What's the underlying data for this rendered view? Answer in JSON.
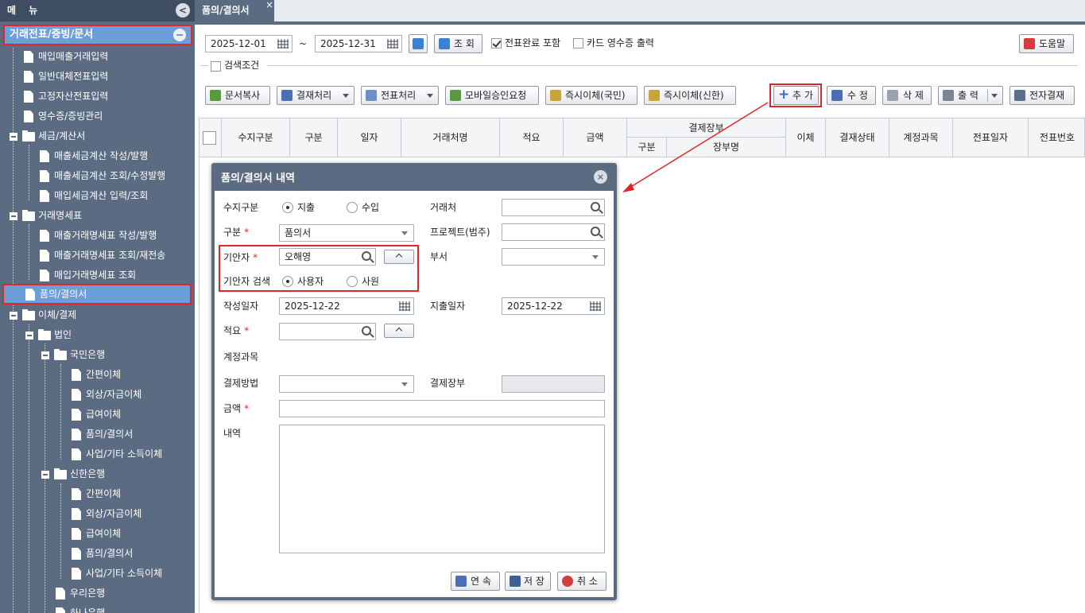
{
  "sidebar": {
    "title": "메 뉴",
    "collapse_icon": "<",
    "group": "거래전표/증빙/문서",
    "items": [
      "매입매출거래입력",
      "일반대체전표입력",
      "고정자산전표입력",
      "영수증/증빙관리",
      "세금/계산서",
      "매출세금계산 작성/발행",
      "매출세금계산 조회/수정발행",
      "매입세금계산 입력/조회",
      "거래명세표",
      "매출거래명세표 작성/발행",
      "매출거래명세표 조회/재전송",
      "매입거래명세표 조회",
      "품의/결의서",
      "이체/결제",
      "법인",
      "국민은행",
      "간편이체",
      "외상/자금이체",
      "급여이체",
      "품의/결의서",
      "사업/기타 소득이체",
      "신한은행",
      "간편이체",
      "외상/자금이체",
      "급여이체",
      "품의/결의서",
      "사업/기타 소득이체",
      "우리은행",
      "하나은행"
    ]
  },
  "tabs": {
    "active": "품의/결의서",
    "close": "×"
  },
  "toolbar": {
    "date_from": "2025-12-01",
    "tilde": "~",
    "date_to": "2025-12-31",
    "search": "조 회",
    "voucher_done": "전표완료 포함",
    "card_receipt": "카드 영수증 출력",
    "help": "도움말",
    "search_cond": "검색조건",
    "doc_copy": "문서복사",
    "approval": "결재처리",
    "voucher": "전표처리",
    "mobile": "모바일승인요청",
    "instant_kb": "즉시이체(국민)",
    "instant_sh": "즉시이체(신한)",
    "add": "추 가",
    "edit": "수 정",
    "delete": "삭 제",
    "print": "출 력",
    "e_approval": "전자결재"
  },
  "grid": {
    "headers": [
      "수지구분",
      "구분",
      "일자",
      "거래처명",
      "적요",
      "금액",
      "결제장부",
      "구분",
      "장부명",
      "이체",
      "결재상태",
      "계정과목",
      "전표일자",
      "전표번호"
    ]
  },
  "dialog": {
    "title": "품의/결의서 내역",
    "close": "×",
    "labels": {
      "type": "수지구분",
      "category": "구분",
      "drafter": "기안자",
      "drafter_search": "기안자 검색",
      "written_date": "작성일자",
      "summary": "적요",
      "account": "계정과목",
      "pay_method": "결제방법",
      "amount": "금액",
      "detail": "내역",
      "client": "거래처",
      "project": "프로젝트(범주)",
      "dept": "부서",
      "expense_date": "지출일자",
      "pay_book": "결제장부"
    },
    "required_mark": "*",
    "radio_expense": "지출",
    "radio_income": "수입",
    "category_value": "품의서",
    "drafter_value": "오해영",
    "radio_user": "사용자",
    "radio_staff": "사원",
    "written_date_value": "2025-12-22",
    "expense_date_value": "2025-12-22",
    "btn_continue": "연 속",
    "btn_save": "저 장",
    "btn_cancel": "취 소"
  }
}
